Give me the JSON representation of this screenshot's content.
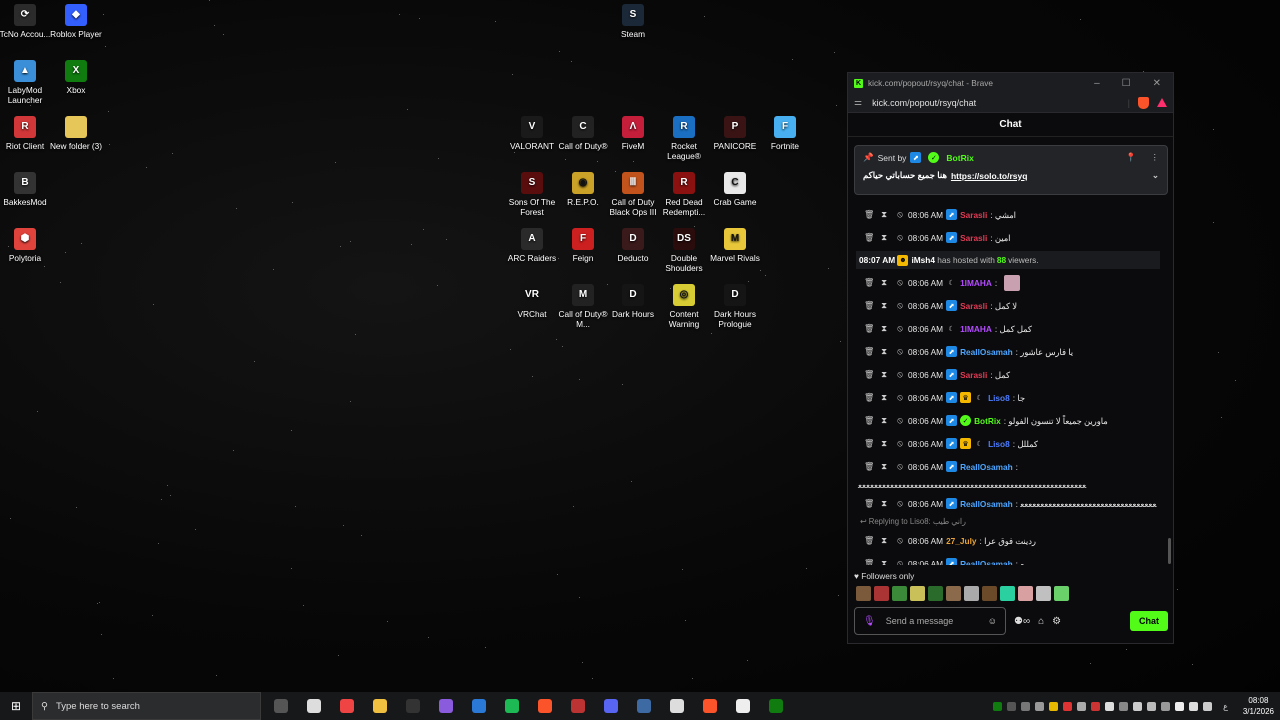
{
  "desktop": {
    "icons": [
      {
        "label": "TcNo Accou...",
        "color": "#2b2b2b",
        "glyph": "⟳"
      },
      {
        "label": "Roblox Player",
        "color": "#335fff",
        "glyph": "◆"
      },
      {
        "label": "LabyMod Launcher",
        "color": "#3a8fd8",
        "glyph": "▲"
      },
      {
        "label": "Xbox",
        "color": "#107c10",
        "glyph": "X"
      },
      {
        "label": "Riot Client",
        "color": "#d13639",
        "glyph": "R"
      },
      {
        "label": "New folder (3)",
        "color": "#e6c659",
        "glyph": ""
      },
      {
        "label": "BakkesMod",
        "color": "#333",
        "glyph": "B"
      },
      {
        "label": "Polytoria",
        "color": "#e0433c",
        "glyph": "⬢"
      },
      {
        "label": "Steam",
        "color": "#1b2838",
        "glyph": "S"
      },
      {
        "label": "VALORANT",
        "color": "#1a1a1a",
        "glyph": "V"
      },
      {
        "label": "Call of Duty®",
        "color": "#222",
        "glyph": "C"
      },
      {
        "label": "FiveM",
        "color": "#c41e3a",
        "glyph": "Λ"
      },
      {
        "label": "Rocket League®",
        "color": "#1a6fc2",
        "glyph": "R"
      },
      {
        "label": "PANICORE",
        "color": "#3a1414",
        "glyph": "P"
      },
      {
        "label": "Fortnite",
        "color": "#48b0f0",
        "glyph": "F"
      },
      {
        "label": "Sons Of The Forest",
        "color": "#5a0d0d",
        "glyph": "S"
      },
      {
        "label": "R.E.P.O.",
        "color": "#c9a227",
        "glyph": "◉"
      },
      {
        "label": "Call of Duty Black Ops III",
        "color": "#c3531c",
        "glyph": "Ⅲ"
      },
      {
        "label": "Red Dead Redempti...",
        "color": "#8b1010",
        "glyph": "R"
      },
      {
        "label": "Crab Game",
        "color": "#e9e9e9",
        "glyph": "C"
      },
      {
        "label": "ARC Raiders",
        "color": "#2a2a2a",
        "glyph": "A"
      },
      {
        "label": "Feign",
        "color": "#cc1f1f",
        "glyph": "F"
      },
      {
        "label": "Deducto",
        "color": "#3a1a1a",
        "glyph": "D"
      },
      {
        "label": "Double Shoulders",
        "color": "#2b0c0c",
        "glyph": "DS"
      },
      {
        "label": "Marvel Rivals",
        "color": "#e8c83a",
        "glyph": "M"
      },
      {
        "label": "VRChat",
        "color": "#111",
        "glyph": "VR"
      },
      {
        "label": "Call of Duty® M...",
        "color": "#222",
        "glyph": "M"
      },
      {
        "label": "Dark Hours",
        "color": "#151515",
        "glyph": "D"
      },
      {
        "label": "Content Warning",
        "color": "#d8cc35",
        "glyph": "◎"
      },
      {
        "label": "Dark Hours Prologue",
        "color": "#151515",
        "glyph": "D"
      }
    ]
  },
  "browser": {
    "title": "kick.com/popout/rsyq/chat - Brave",
    "url": "kick.com/popout/rsyq/chat"
  },
  "chat": {
    "header": "Chat",
    "pinned": {
      "sent_by": "Sent by",
      "user": "BotRix",
      "text": "هنا جميع حساباتي حياكم",
      "link": "https://solo.to/rsyq"
    },
    "messages": [
      {
        "time": "08:06 AM",
        "user": "Sarasli",
        "color": "#e23a55",
        "text": "امشي",
        "badges": [
          "blue"
        ]
      },
      {
        "time": "08:06 AM",
        "user": "Sarasli",
        "color": "#e23a55",
        "text": "امين",
        "badges": [
          "blue"
        ]
      },
      {
        "host": true,
        "time": "08:07 AM",
        "user": "iMsh4",
        "text1": "has hosted with",
        "count": "88",
        "text2": "viewers."
      },
      {
        "time": "08:06 AM",
        "user": "1IMAHA",
        "color": "#b44dff",
        "text": "",
        "badges": [
          "moon"
        ],
        "emote": true
      },
      {
        "time": "08:06 AM",
        "user": "Sarasli",
        "color": "#e23a55",
        "text": "لا كمل",
        "badges": [
          "blue"
        ]
      },
      {
        "time": "08:06 AM",
        "user": "1IMAHA",
        "color": "#b44dff",
        "text": "كمل كمل",
        "badges": [
          "moon"
        ]
      },
      {
        "time": "08:06 AM",
        "user": "ReallOsamah",
        "color": "#4da6ff",
        "text": "يا فارس عاشور",
        "badges": [
          "blue"
        ]
      },
      {
        "time": "08:06 AM",
        "user": "Sarasli",
        "color": "#e23a55",
        "text": "كمل",
        "badges": [
          "blue"
        ]
      },
      {
        "time": "08:06 AM",
        "user": "Liso8",
        "color": "#4d7dff",
        "text": "جا",
        "badges": [
          "blue",
          "gold",
          "moon"
        ]
      },
      {
        "time": "08:06 AM",
        "user": "BotRix",
        "color": "#53fc18",
        "text": "ماورين جميعاً لا تنسون الفولو",
        "badges": [
          "blue",
          "green"
        ]
      },
      {
        "time": "08:06 AM",
        "user": "Liso8",
        "color": "#4d7dff",
        "text": "كمللل",
        "badges": [
          "blue",
          "gold",
          "moon"
        ]
      },
      {
        "time": "08:06 AM",
        "user": "ReallOsamah",
        "color": "#4da6ff",
        "text": "",
        "badges": [
          "blue"
        ],
        "wrap": "ﻌﻌﻌﻌﻌﻌﻌﻌﻌﻌﻌﻌﻌﻌﻌﻌﻌﻌﻌﻌﻌﻌﻌﻌﻌﻌﻌﻌﻌﻌﻌﻌﻌﻌﻌﻌﻌﻌﻌﻌﻌﻌﻌﻌﻌﻌﻌﻌﻌﻌﻌﻌﻌﻌﻌﻌﻌ"
      },
      {
        "time": "08:06 AM",
        "user": "ReallOsamah",
        "color": "#4da6ff",
        "text": "ﻌﻌﻌﻌﻌﻌﻌﻌﻌﻌﻌﻌﻌﻌﻌﻌﻌﻌﻌﻌﻌﻌﻌﻌﻌﻌﻌﻌﻌﻌﻌﻌﻌﻌ",
        "badges": [
          "blue"
        ]
      },
      {
        "reply": "Replying to Liso8: راني طيب"
      },
      {
        "time": "08:06 AM",
        "user": "27_July",
        "color": "#e8a33a",
        "text": "ردينت فوق عرا",
        "badges": []
      },
      {
        "time": "08:06 AM",
        "user": "ReallOsamah",
        "color": "#4da6ff",
        "text": "ه",
        "badges": [
          "blue"
        ]
      }
    ],
    "followers_only": "Followers only",
    "emote_colors": [
      "#7a5a3a",
      "#a33",
      "#3a8a3a",
      "#c9c05a",
      "#2a6a2a",
      "#8a6a4a",
      "#aaa",
      "#6b4a2a",
      "#2ad0a0",
      "#d8a0a0",
      "#c0c0c0",
      "#6ad06a"
    ],
    "input_placeholder": "Send a message",
    "send_label": "Chat"
  },
  "taskbar": {
    "search_placeholder": "Type here to search",
    "apps": [
      {
        "name": "task-view",
        "color": "#555"
      },
      {
        "name": "steam-alt",
        "color": "#ddd"
      },
      {
        "name": "chrome",
        "color": "#e44"
      },
      {
        "name": "file-explorer",
        "color": "#f0c040"
      },
      {
        "name": "obs",
        "color": "#333"
      },
      {
        "name": "discord-ptb",
        "color": "#8a5bdc"
      },
      {
        "name": "store",
        "color": "#2b79d6"
      },
      {
        "name": "spotify",
        "color": "#1db954"
      },
      {
        "name": "brave",
        "color": "#fb542b"
      },
      {
        "name": "game-launcher",
        "color": "#b33"
      },
      {
        "name": "discord",
        "color": "#5865f2"
      },
      {
        "name": "steam",
        "color": "#3d6aa3"
      },
      {
        "name": "g-app",
        "color": "#ddd"
      },
      {
        "name": "brave-2",
        "color": "#fb542b"
      },
      {
        "name": "ms-store",
        "color": "#eee"
      },
      {
        "name": "xbox",
        "color": "#107c10"
      }
    ],
    "clock_time": "08:08",
    "clock_date": "3/1/2026",
    "lang": "ع"
  }
}
